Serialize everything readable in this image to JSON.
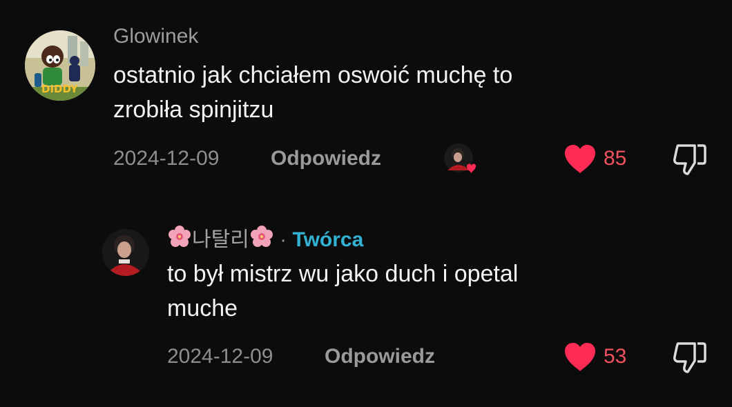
{
  "comments": [
    {
      "username": "Glowinek",
      "avatar_text": "DIDDY",
      "text_line1": "ostatnio jak chciałem oswoić muchę to",
      "text_line2": "zrobiła spinjitzu",
      "date": "2024-12-09",
      "reply_label": "Odpowiedz",
      "likes": "85"
    }
  ],
  "reply": {
    "username_core": "나탈리",
    "separator": "·",
    "creator_label": "Twórca",
    "text_line1": "to był mistrz wu jako duch i opetal",
    "text_line2": "muche",
    "date": "2024-12-09",
    "reply_label": "Odpowiedz",
    "likes": "53"
  },
  "colors": {
    "background": "#0c0c0d",
    "heart": "#fe2c55",
    "like_count": "#f2525f",
    "creator": "#33b3d4"
  },
  "icons": [
    "heart-icon",
    "dislike-icon",
    "liked-by-creator-avatar",
    "flower-icon"
  ]
}
